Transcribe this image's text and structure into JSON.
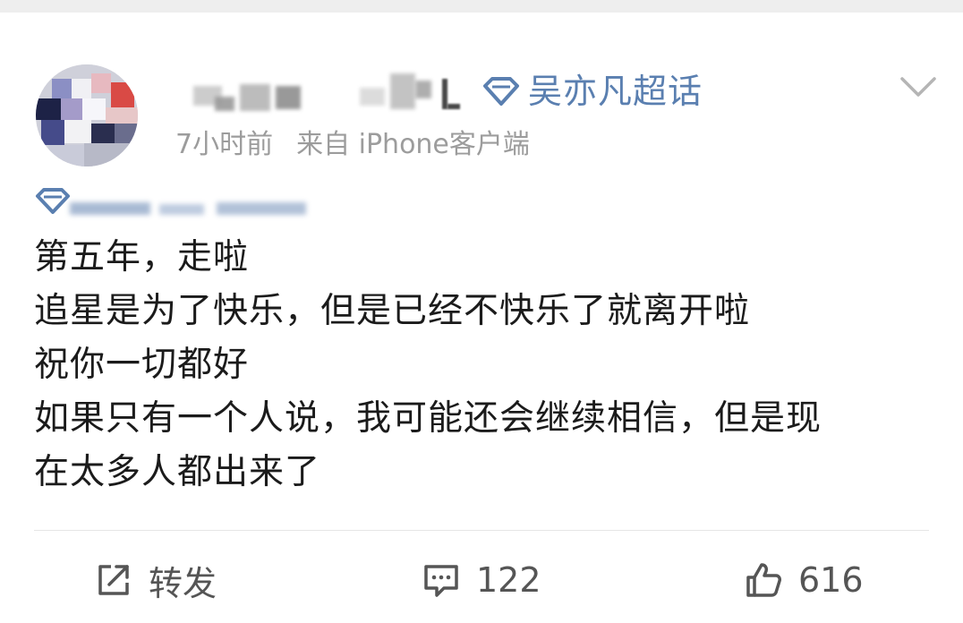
{
  "post": {
    "supertopic": "吴亦凡超话",
    "time": "7小时前",
    "source": "来自 iPhone客户端",
    "lines": [
      "第五年，走啦",
      "追星是为了快乐，但是已经不快乐了就离开啦",
      "祝你一切都好",
      "如果只有一个人说，我可能还会继续相信，但是现",
      "在太多人都出来了"
    ]
  },
  "actions": {
    "repost_label": "转发",
    "comment_count": "122",
    "like_count": "616"
  },
  "colors": {
    "accent": "#5a7fb0",
    "meta": "#9c9c9c",
    "text": "#1b1b1b"
  },
  "icons": [
    "diamond-icon",
    "chevron-down-icon",
    "repost-icon",
    "comment-icon",
    "like-icon"
  ]
}
